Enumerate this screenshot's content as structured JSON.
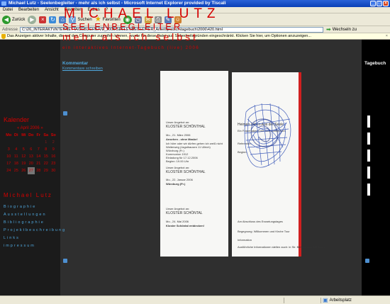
{
  "window": {
    "title": "Michael Lutz - Seelenbegleiter - mehr als ich selbst - Microsoft Internet Explorer provided by Tiscali"
  },
  "menu": [
    "Datei",
    "Bearbeiten",
    "Ansicht",
    "Favoriten",
    "Extras",
    "?"
  ],
  "toolbar": {
    "back_label": "Zurück",
    "search_label": "Suchen",
    "favorites_label": "Favoriten"
  },
  "address": {
    "label": "Adresse",
    "value": "C:\\26_INTERAKT\\INTERNETTAGEBUCH\\LIVE_2005\\SEELENBEGLEITER_Arbeit\\pratsch\\tagebuch\\2006\\420.html",
    "go_label": "Wechseln zu"
  },
  "infobar": {
    "text": "Das Anzeigen aktiver Inhalte, die auf den Computer zugreifen können, wurde für diese Datei aus Sicherheitsgründen eingeschränkt. Klicken Sie hier, um Optionen anzuzeigen..."
  },
  "page": {
    "heading": "MICHAEL LUTZ",
    "subheading": "SEELENBEGLEITER",
    "subheading2": "mehr als ich selbst",
    "tagline": "ein interaktives Internet-Tagebuch (live) 2006",
    "kommentar_title": "Kommentar",
    "kommentar_link": "Kommentare schreiben",
    "tagebuch_title": "Tagebuch"
  },
  "calendar": {
    "title": "Kalender",
    "month": "« April 2006 »",
    "headers": [
      "Mo",
      "Di",
      "Mi",
      "Do",
      "Fr",
      "Sa",
      "So"
    ],
    "rows": [
      [
        "",
        "",
        "",
        "",
        "",
        "1",
        "2"
      ],
      [
        "3",
        "4",
        "5",
        "6",
        "7",
        "8",
        "9"
      ],
      [
        "10",
        "11",
        "12",
        "13",
        "14",
        "15",
        "16"
      ],
      [
        "17",
        "18",
        "19",
        "20",
        "21",
        "22",
        "23"
      ],
      [
        "24",
        "25",
        "26",
        "27",
        "28",
        "29",
        "30"
      ]
    ]
  },
  "sidebar": {
    "name": "Michael Lutz",
    "links": [
      "Biographie",
      "Ausstellungen",
      "Bibliographie",
      "Projektbeschreibung",
      "Links",
      "impressum"
    ]
  },
  "document": {
    "left_lines": [
      "Unser Angebot an:",
      "KLOSTER SCHÖNTHAL",
      "Mo., 21. März 2006",
      "Ansehen - ohne Maske!",
      "Ich höre oder wir dürfen gehen ich weiß nicht",
      "Weiterweg (Jagsthausen 11 Ullrich)",
      "Würzburg (Fr.)",
      "Kommunion 1912",
      "Einladung für 17.12.2006",
      "Beginn: 19.00 Uhr",
      "Unser Angebot an:",
      "KLOSTER SCHÖNTHAL",
      "Mo., 22. Januar 2006",
      "Würzburg (Fr.)",
      "Unser Angebot an:",
      "KLOSTER SCHÖNTAL",
      "Mo., 24. Mai 2006",
      "Kloster Schöntal entdecken!"
    ],
    "right_lines": [
      "Heimen Leben Aus der Seele",
      "Ein Frauenabend mit Schreibimpulsen",
      "Referentin:",
      "Beginn:",
      "Am Abschluss des Erwartungstages",
      "Begegnung: Willkommen und Kirche Tour",
      "Information",
      "Ausführliche Informationen stellen auch: in Str. Bernhardin / Mirsbach"
    ]
  },
  "status": {
    "main": "",
    "zone": "Arbeitsplatz"
  }
}
